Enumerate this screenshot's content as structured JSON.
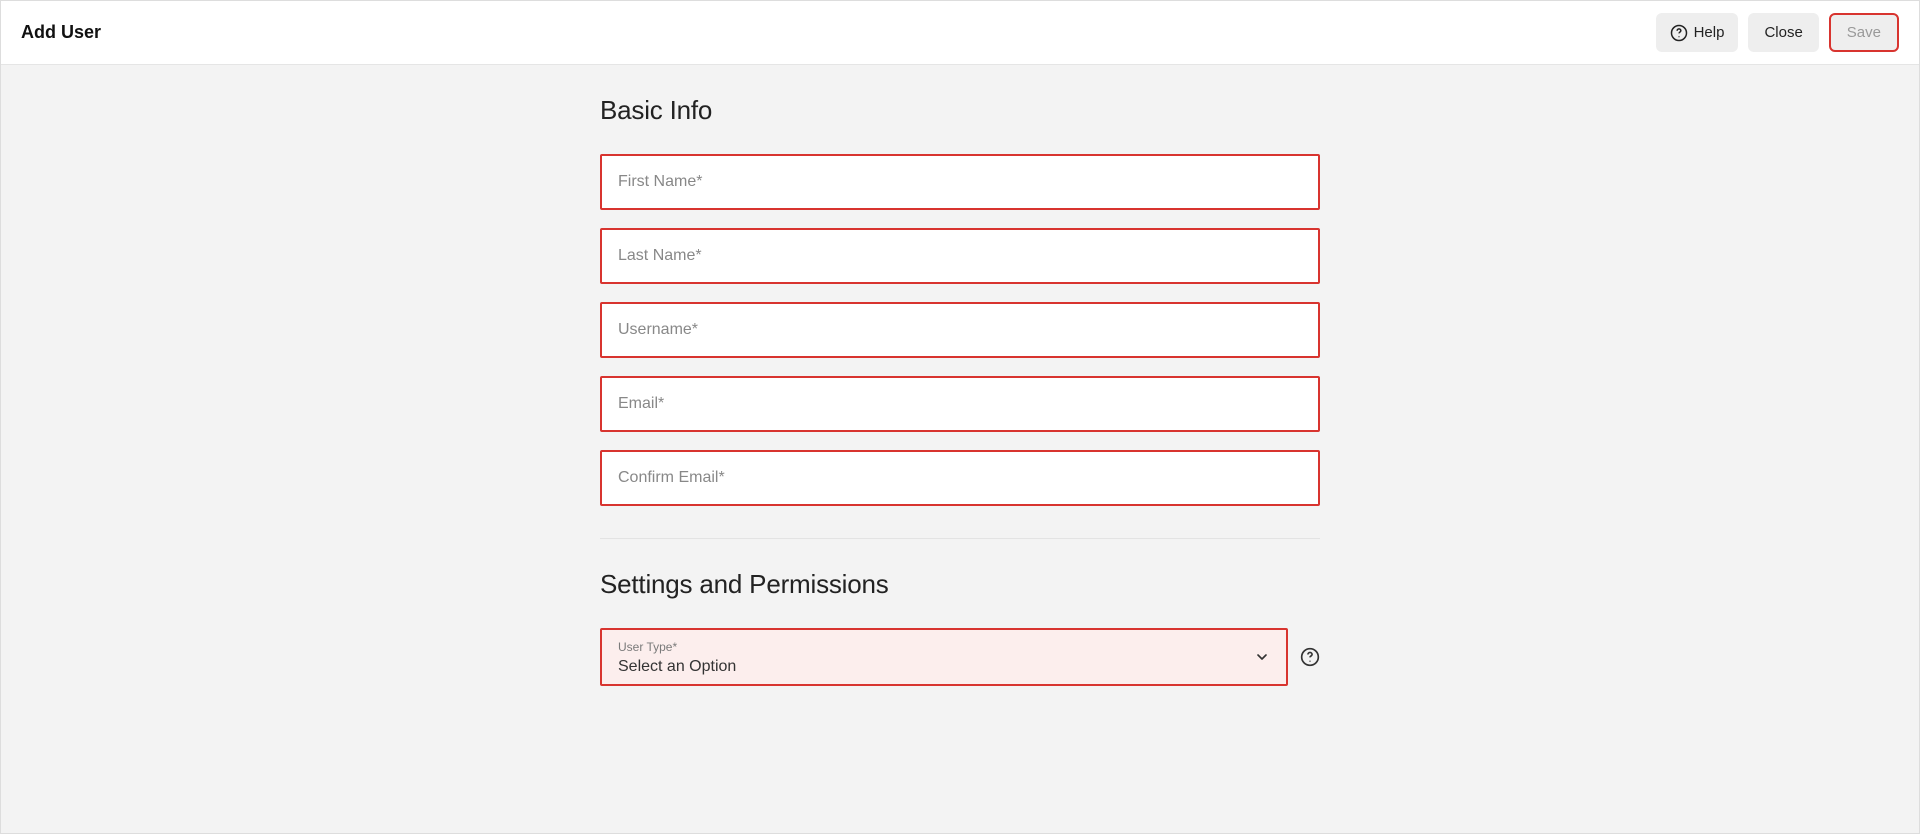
{
  "header": {
    "title": "Add User",
    "help_label": "Help",
    "close_label": "Close",
    "save_label": "Save"
  },
  "sections": {
    "basic_info": {
      "title": "Basic Info",
      "fields": {
        "first_name_placeholder": "First Name*",
        "last_name_placeholder": "Last Name*",
        "username_placeholder": "Username*",
        "email_placeholder": "Email*",
        "confirm_email_placeholder": "Confirm Email*"
      }
    },
    "settings": {
      "title": "Settings and Permissions",
      "user_type_label": "User Type*",
      "user_type_value": "Select an Option"
    }
  }
}
